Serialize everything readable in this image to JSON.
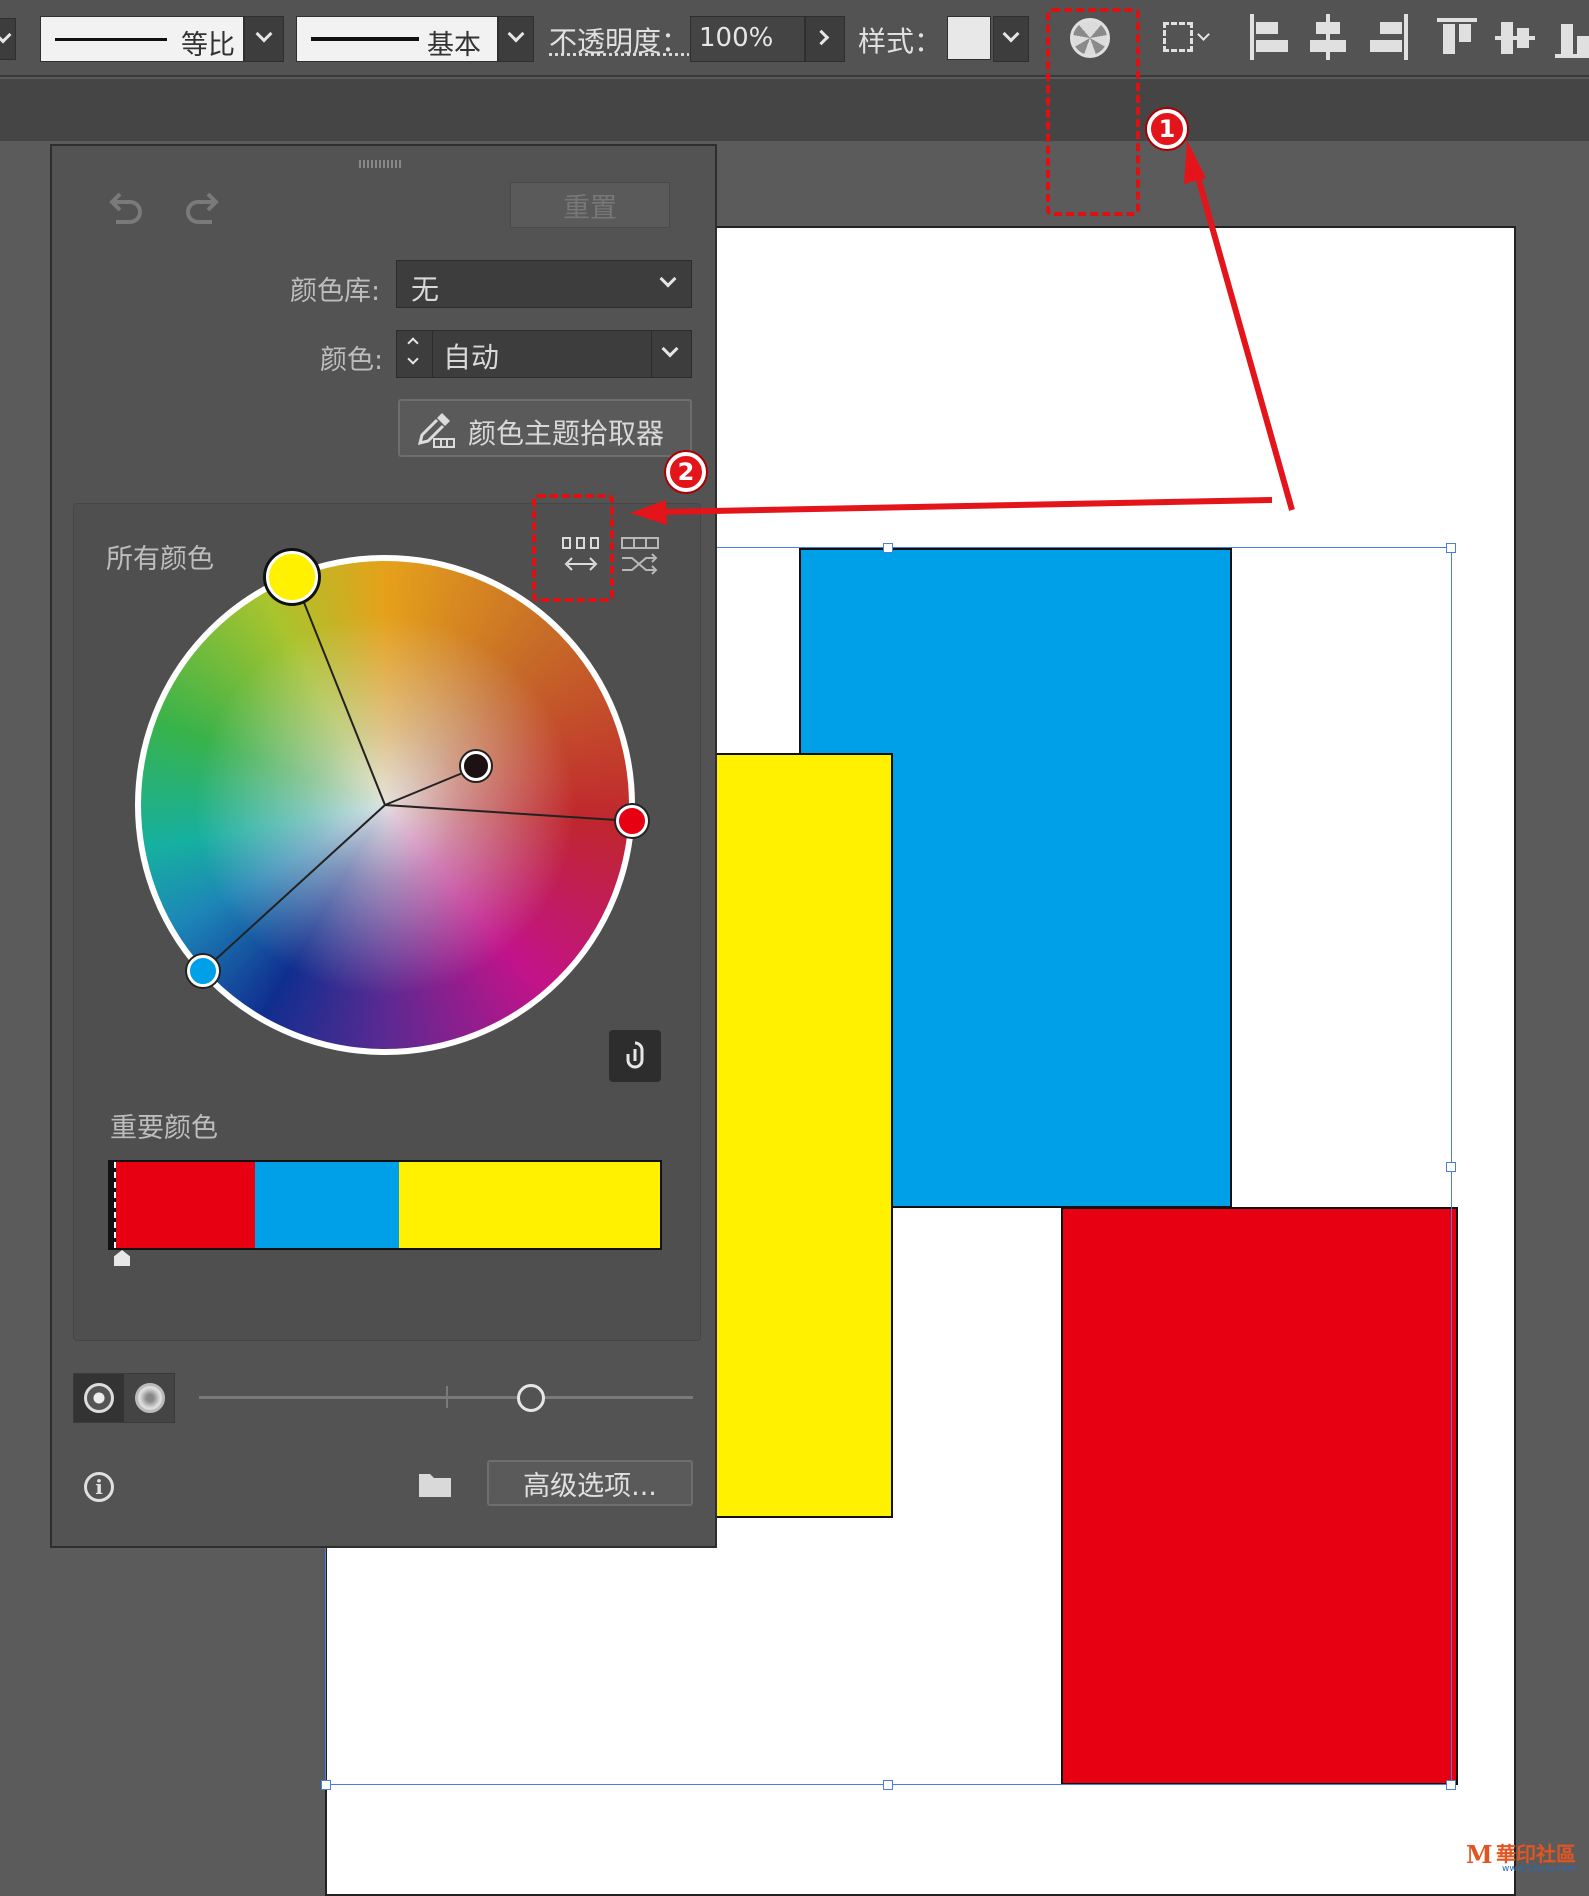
{
  "control_bar": {
    "stroke_profile_label": "等比",
    "brush_label": "基本",
    "opacity_label": "不透明度：",
    "opacity_value": "100%",
    "style_label": "样式："
  },
  "panel": {
    "reset_label": "重置",
    "library_label": "颜色库:",
    "library_value": "无",
    "colors_label": "颜色:",
    "colors_value": "自动",
    "picker_label": "颜色主题拾取器",
    "all_colors_label": "所有颜色",
    "important_colors_label": "重要颜色",
    "advanced_label": "高级选项...",
    "important_colors": [
      {
        "color": "#e60012",
        "fraction": 0.25
      },
      {
        "color": "#00a0e9",
        "fraction": 0.26
      },
      {
        "color": "#fff100",
        "fraction": 0.47
      }
    ]
  },
  "annotations": {
    "badge_1": "1",
    "badge_2": "2"
  },
  "watermark": {
    "text": "華印社區",
    "url": "www.52cnp.com"
  },
  "colors": {
    "red": "#e60012",
    "blue": "#00a0e9",
    "yellow": "#fff100",
    "annotation": "#e3141a"
  }
}
